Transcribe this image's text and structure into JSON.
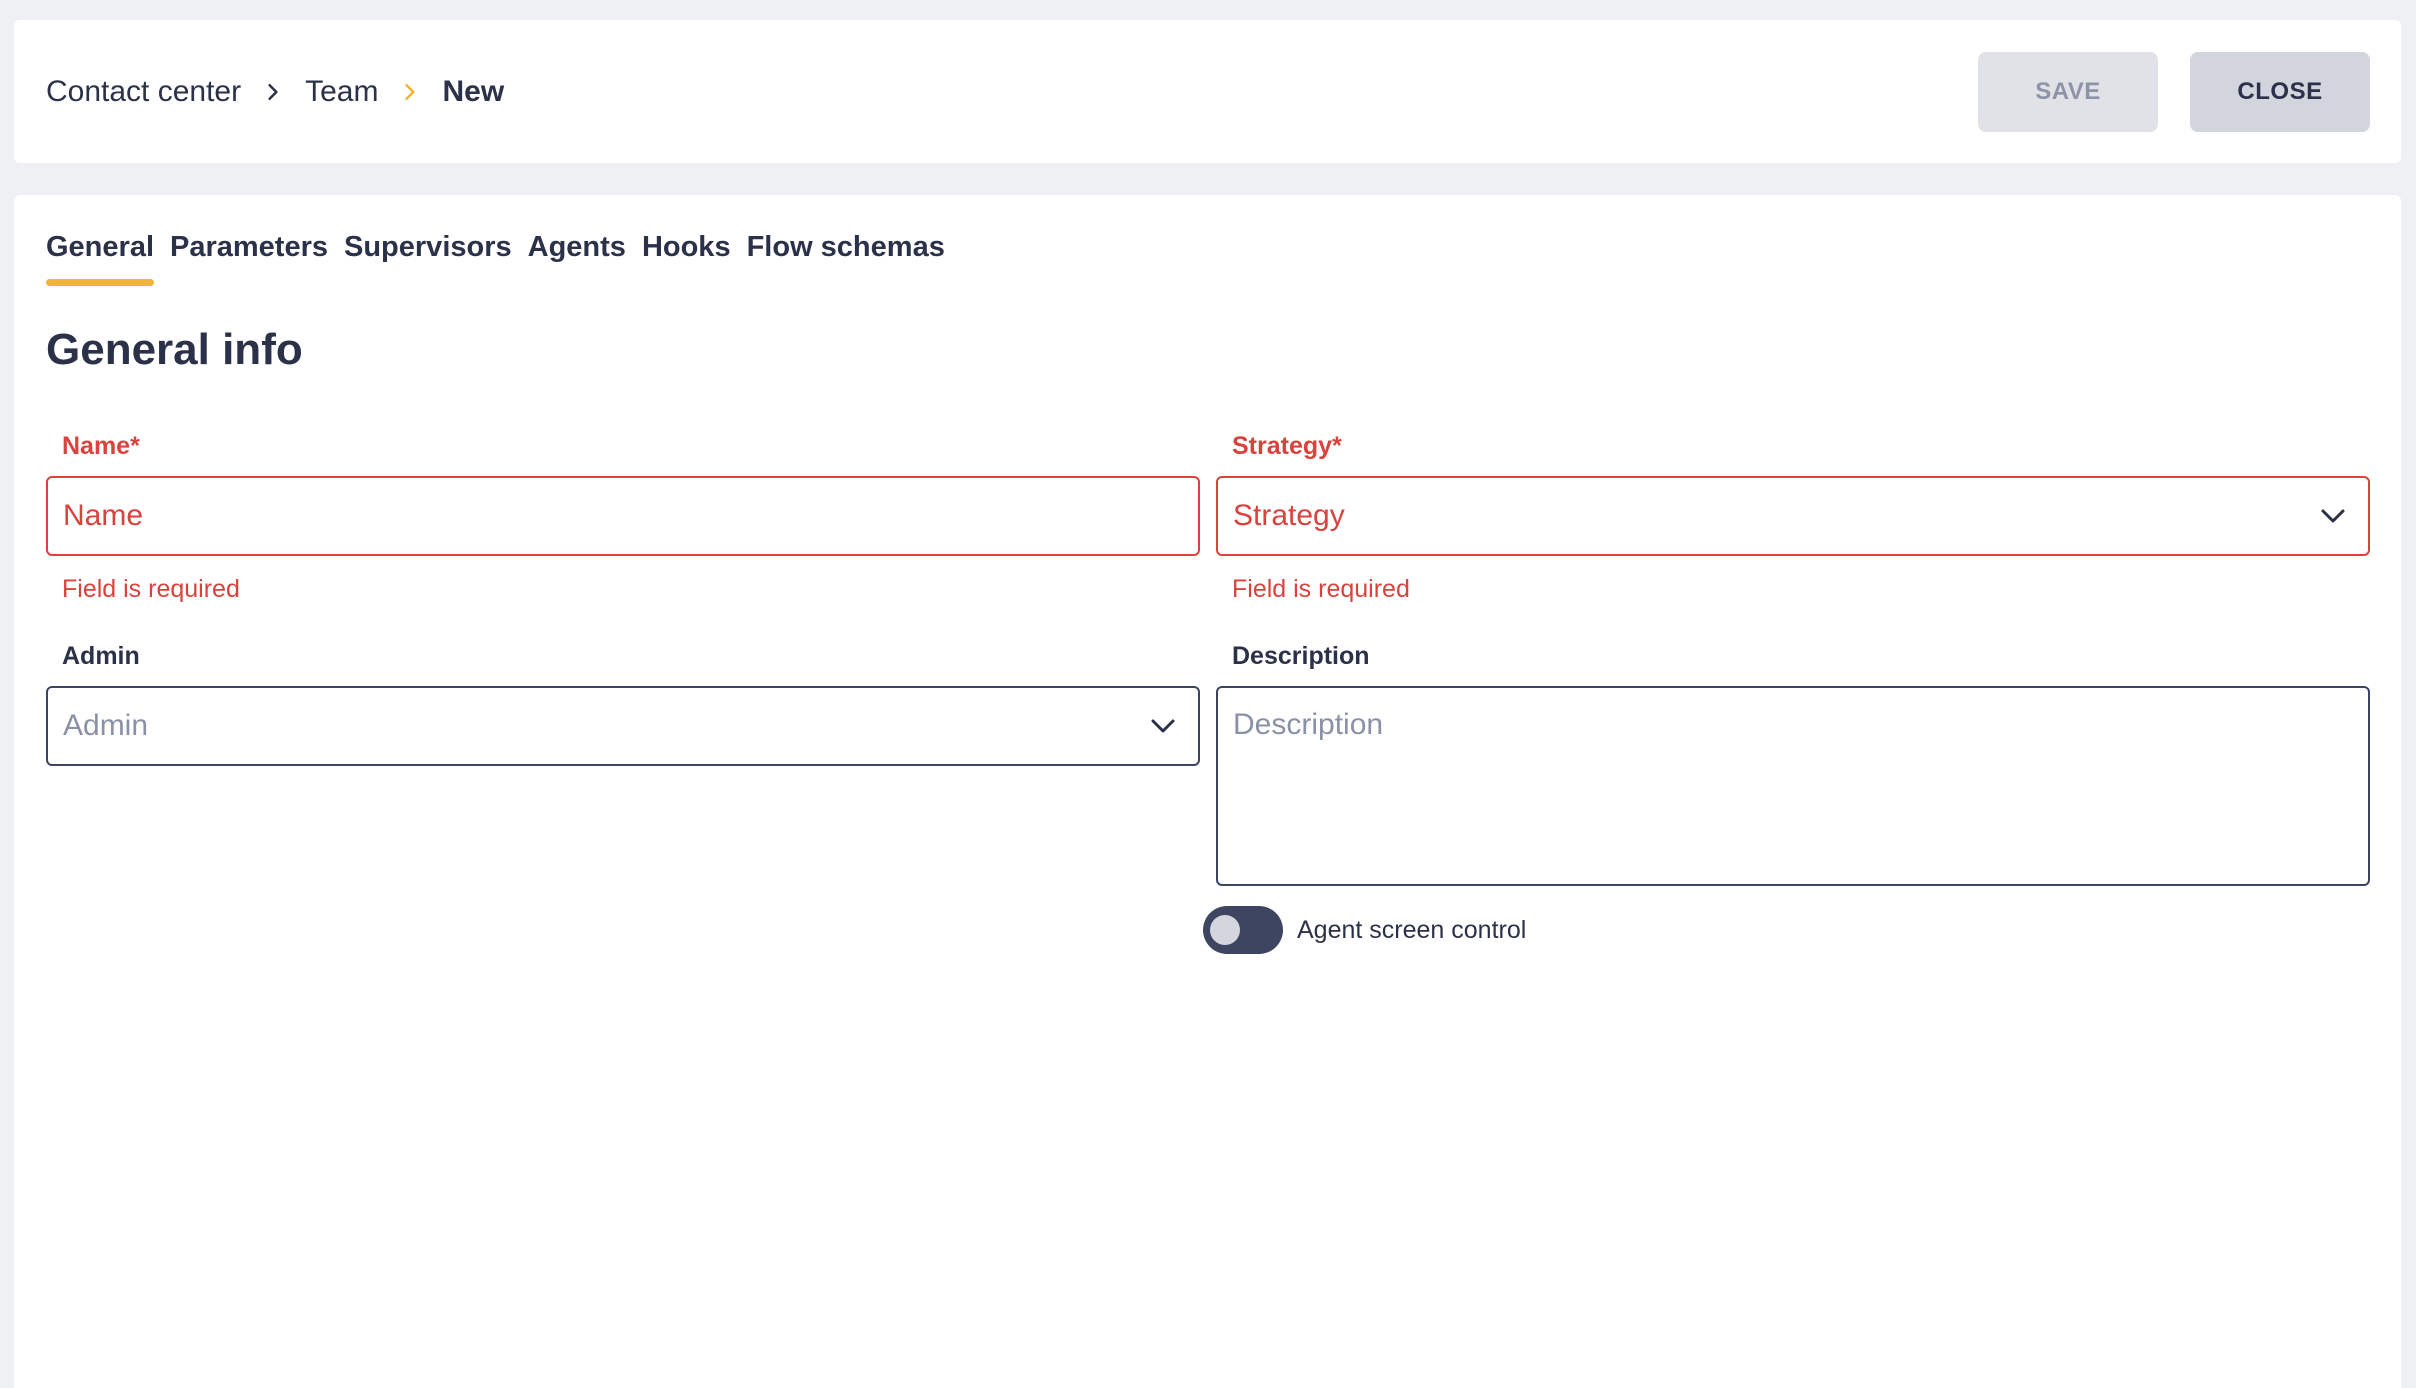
{
  "breadcrumb": {
    "items": [
      "Contact center",
      "Team",
      "New"
    ],
    "separator_colors": [
      "#2b3148",
      "#f2b434"
    ]
  },
  "actions": {
    "save_label": "SAVE",
    "close_label": "CLOSE"
  },
  "tabs": [
    {
      "label": "General",
      "active": true
    },
    {
      "label": "Parameters",
      "active": false
    },
    {
      "label": "Supervisors",
      "active": false
    },
    {
      "label": "Agents",
      "active": false
    },
    {
      "label": "Hooks",
      "active": false
    },
    {
      "label": "Flow schemas",
      "active": false
    }
  ],
  "section": {
    "title": "General info"
  },
  "form": {
    "name": {
      "label": "Name*",
      "placeholder": "Name",
      "value": "",
      "error": "Field is required"
    },
    "strategy": {
      "label": "Strategy*",
      "placeholder": "Strategy",
      "value": "",
      "error": "Field is required"
    },
    "admin": {
      "label": "Admin",
      "placeholder": "Admin",
      "value": ""
    },
    "description": {
      "label": "Description",
      "placeholder": "Description",
      "value": ""
    },
    "agent_screen_control": {
      "label": "Agent screen control",
      "enabled": false
    }
  },
  "colors": {
    "accent": "#f2b434",
    "error": "#d9423d",
    "text": "#2b3148",
    "toggle_track": "#3d4560"
  },
  "icons": {
    "breadcrumb_separator": "chevron-right-icon",
    "select_arrow": "chevron-down-icon"
  }
}
